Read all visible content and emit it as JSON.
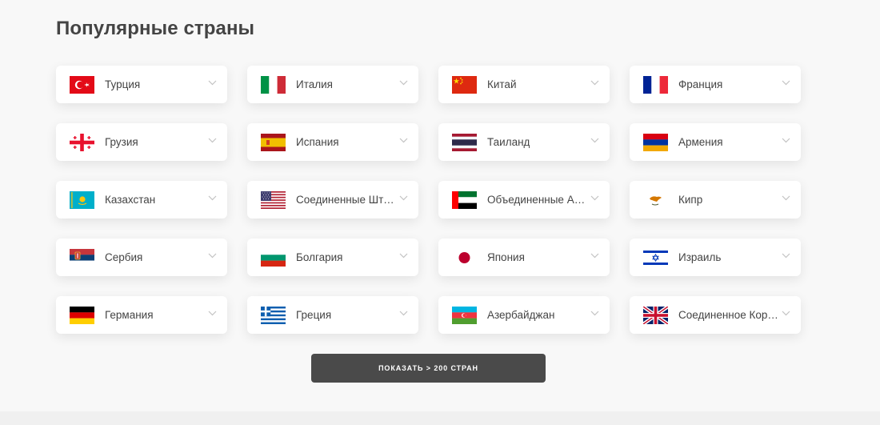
{
  "section": {
    "title": "Популярные страны"
  },
  "countries": [
    {
      "name": "Турция",
      "flag": "turkey-flag-icon"
    },
    {
      "name": "Италия",
      "flag": "italy-flag-icon"
    },
    {
      "name": "Китай",
      "flag": "china-flag-icon"
    },
    {
      "name": "Франция",
      "flag": "france-flag-icon"
    },
    {
      "name": "Грузия",
      "flag": "georgia-flag-icon"
    },
    {
      "name": "Испания",
      "flag": "spain-flag-icon"
    },
    {
      "name": "Таиланд",
      "flag": "thailand-flag-icon"
    },
    {
      "name": "Армения",
      "flag": "armenia-flag-icon"
    },
    {
      "name": "Казахстан",
      "flag": "kazakhstan-flag-icon"
    },
    {
      "name": "Соединенные Штат...",
      "flag": "usa-flag-icon"
    },
    {
      "name": "Объединенные Ара...",
      "flag": "uae-flag-icon"
    },
    {
      "name": "Кипр",
      "flag": "cyprus-flag-icon"
    },
    {
      "name": "Сербия",
      "flag": "serbia-flag-icon"
    },
    {
      "name": "Болгария",
      "flag": "bulgaria-flag-icon"
    },
    {
      "name": "Япония",
      "flag": "japan-flag-icon"
    },
    {
      "name": "Израиль",
      "flag": "israel-flag-icon"
    },
    {
      "name": "Германия",
      "flag": "germany-flag-icon"
    },
    {
      "name": "Греция",
      "flag": "greece-flag-icon"
    },
    {
      "name": "Азербайджан",
      "flag": "azerbaijan-flag-icon"
    },
    {
      "name": "Соединенное Коро...",
      "flag": "uk-flag-icon"
    }
  ],
  "show_more": {
    "label": "ПОКАЗАТЬ > 200 СТРАН"
  },
  "colors": {
    "button": "#4a4a4a",
    "text": "#444444",
    "card": "#ffffff",
    "background": "#f8f8f8"
  }
}
